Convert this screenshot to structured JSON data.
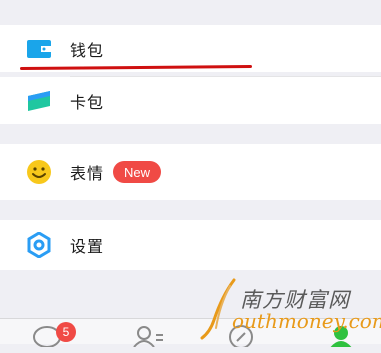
{
  "menu": {
    "wallet": {
      "label": "钱包",
      "icon": "wallet-icon",
      "color": "#1aa5ea"
    },
    "cards": {
      "label": "卡包",
      "icon": "card-pack-icon",
      "color": "#1fc7a0"
    },
    "stickers": {
      "label": "表情",
      "icon": "smiley-icon",
      "color": "#f8c81b",
      "badge": "New"
    },
    "settings": {
      "label": "设置",
      "icon": "gear-icon",
      "color": "#2a9df4"
    }
  },
  "tabbar": {
    "chats_badge": "5",
    "tabs": [
      "chats-tab",
      "contacts-tab",
      "discover-tab",
      "me-tab"
    ]
  },
  "watermark": {
    "cn": "南方财富网",
    "en": "outhmoney.com"
  },
  "colors": {
    "annotation_red": "#cf1010",
    "badge_red": "#f04a45",
    "background": "#efeff4"
  }
}
